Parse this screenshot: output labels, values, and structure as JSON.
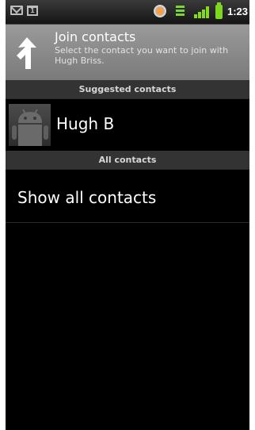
{
  "status_bar": {
    "time": "1:23",
    "calendar_day": "1",
    "icons": [
      "gmail-icon",
      "calendar-icon",
      "gps-icon",
      "data-icon",
      "signal-icon",
      "battery-icon"
    ],
    "accent_color": "#84da20"
  },
  "title_bar": {
    "title": "Join contacts",
    "subtitle": "Select the contact you want to join with Hugh Briss.",
    "icon": "up-arrow-icon"
  },
  "sections": {
    "suggested_header": "Suggested contacts",
    "all_header": "All contacts"
  },
  "suggested_contacts": [
    {
      "name": "Hugh B",
      "avatar": "android-avatar-icon"
    }
  ],
  "show_all_label": "Show all contacts"
}
